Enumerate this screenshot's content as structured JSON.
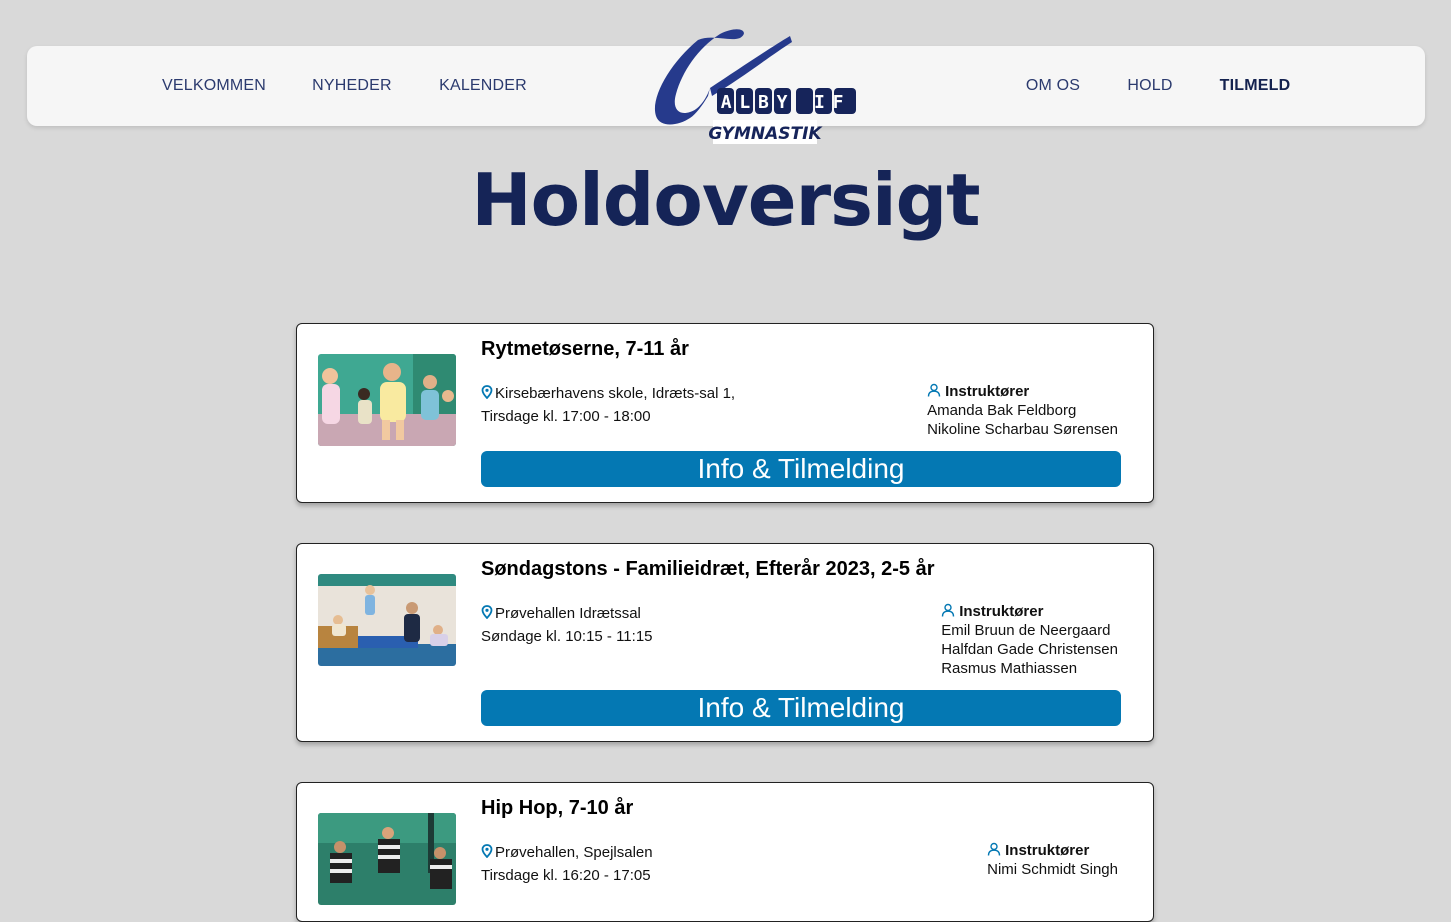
{
  "nav": {
    "left": [
      "VELKOMMEN",
      "NYHEDER",
      "KALENDER"
    ],
    "right": [
      "OM OS",
      "HOLD",
      "TILMELD"
    ],
    "active": "TILMELD"
  },
  "logo": {
    "top_text": "ALBY IF",
    "bottom_text": "GYMNASTIK"
  },
  "page_title": "Holdoversigt",
  "colors": {
    "accent": "#0478b3",
    "brand": "#263a8c",
    "title": "#152457",
    "background": "#d9d9d9"
  },
  "instructors_heading": "Instruktører",
  "cta_label": "Info & Tilmelding",
  "teams": [
    {
      "title": "Rytmetøserne, 7-11 år",
      "location": "Kirsebærhavens skole, Idræts-sal 1,",
      "schedule": "Tirsdage kl. 17:00 - 18:00",
      "instructors": [
        "Amanda Bak Feldborg",
        "Nikoline Scharbau Sørensen"
      ]
    },
    {
      "title": "Søndagstons - Familieidræt, Efterår 2023, 2-5 år",
      "location": "Prøvehallen Idrætssal",
      "schedule": "Søndage kl. 10:15 - 11:15",
      "instructors": [
        "Emil Bruun de Neergaard",
        "Halfdan Gade Christensen",
        "Rasmus Mathiassen"
      ]
    },
    {
      "title": "Hip Hop, 7-10 år",
      "location": "Prøvehallen, Spejlsalen",
      "schedule": "Tirsdage kl. 16:20 - 17:05",
      "instructors": [
        "Nimi Schmidt Singh"
      ]
    }
  ]
}
